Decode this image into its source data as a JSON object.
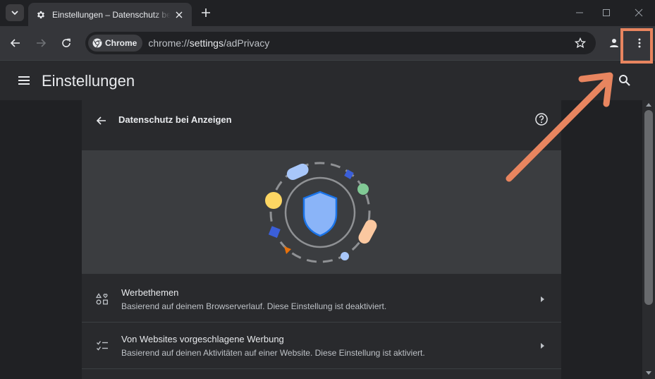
{
  "tab": {
    "title": "Einstellungen – Datenschutz bei Anzeigen"
  },
  "omnibox": {
    "chip_label": "Chrome",
    "url_scheme": "chrome://",
    "url_host": "settings",
    "url_path": "/adPrivacy"
  },
  "header": {
    "title": "Einstellungen"
  },
  "page": {
    "title": "Datenschutz bei Anzeigen",
    "rows": [
      {
        "title": "Werbethemen",
        "subtitle": "Basierend auf deinem Browserverlauf. Diese Einstellung ist deaktiviert."
      },
      {
        "title": "Von Websites vorgeschlagene Werbung",
        "subtitle": "Basierend auf deinen Aktivitäten auf einer Website. Diese Einstellung ist aktiviert."
      }
    ]
  },
  "colors": {
    "annotation": "#e8855f",
    "shield": "#8ab4f8",
    "shield_outline": "#1a73e8"
  },
  "icons": [
    "tab-search-icon",
    "settings-gear-icon",
    "close-icon",
    "plus-icon",
    "minimize-icon",
    "maximize-icon",
    "back-icon",
    "forward-icon",
    "reload-icon",
    "chrome-logo-icon",
    "star-icon",
    "profile-icon",
    "more-vert-icon",
    "hamburger-icon",
    "search-icon",
    "help-icon",
    "ad-topics-icon",
    "site-suggested-ads-icon",
    "chevron-right-icon"
  ]
}
